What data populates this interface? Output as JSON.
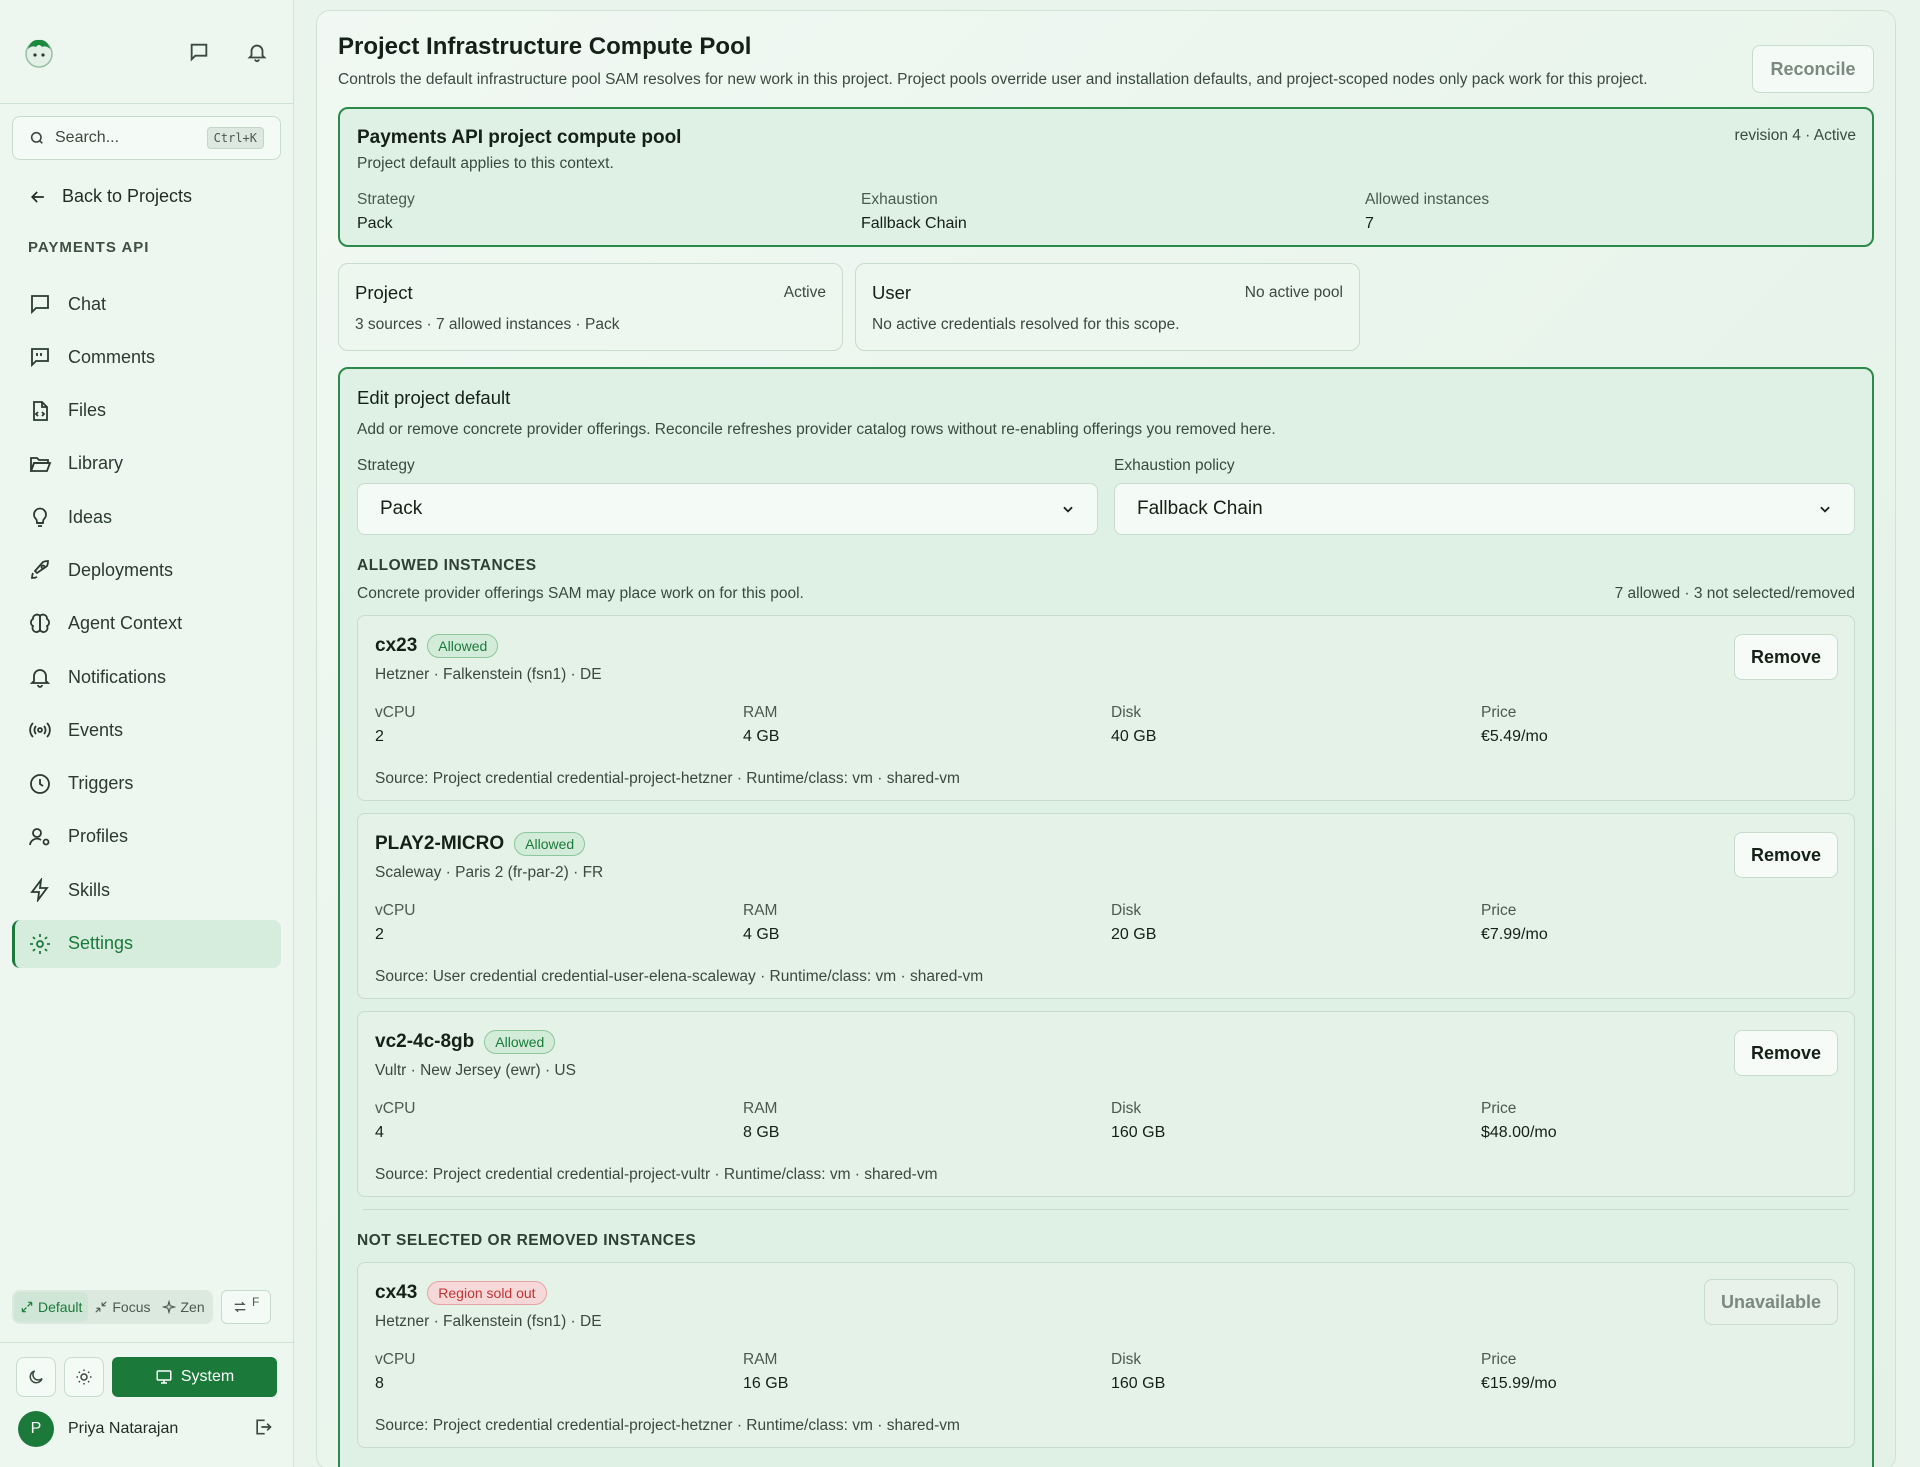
{
  "sidebar": {
    "search_placeholder": "Search...",
    "search_shortcut": "Ctrl+K",
    "back_label": "Back to Projects",
    "project_label": "PAYMENTS API",
    "items": [
      {
        "label": "Chat",
        "icon": "chat-icon"
      },
      {
        "label": "Comments",
        "icon": "comments-icon"
      },
      {
        "label": "Files",
        "icon": "file-code-icon"
      },
      {
        "label": "Library",
        "icon": "folder-open-icon"
      },
      {
        "label": "Ideas",
        "icon": "lightbulb-icon"
      },
      {
        "label": "Deployments",
        "icon": "rocket-icon"
      },
      {
        "label": "Agent Context",
        "icon": "brain-icon"
      },
      {
        "label": "Notifications",
        "icon": "bell-icon"
      },
      {
        "label": "Events",
        "icon": "radio-icon"
      },
      {
        "label": "Triggers",
        "icon": "clock-icon"
      },
      {
        "label": "Profiles",
        "icon": "user-cog-icon"
      },
      {
        "label": "Skills",
        "icon": "bolt-icon"
      },
      {
        "label": "Settings",
        "icon": "gear-icon",
        "active": true
      }
    ],
    "layout_modes": {
      "default": "Default",
      "focus": "Focus",
      "zen": "Zen",
      "toggle_key": "F"
    },
    "theme_system": "System",
    "user": {
      "initial": "P",
      "name": "Priya Natarajan"
    }
  },
  "header": {
    "title": "Project Infrastructure Compute Pool",
    "description": "Controls the default infrastructure pool SAM resolves for new work in this project. Project pools override user and installation defaults, and project-scoped nodes only pack work for this project.",
    "reconcile_label": "Reconcile"
  },
  "pool": {
    "name": "Payments API project compute pool",
    "subtitle": "Project default applies to this context.",
    "revision": "revision 4 · Active",
    "fields": [
      {
        "key": "Strategy",
        "value": "Pack"
      },
      {
        "key": "Exhaustion",
        "value": "Fallback Chain"
      },
      {
        "key": "Allowed instances",
        "value": "7"
      }
    ]
  },
  "scopes": [
    {
      "name": "Project",
      "state": "Active",
      "desc": "3 sources · 7 allowed instances · Pack"
    },
    {
      "name": "User",
      "state": "No active pool",
      "desc": "No active credentials resolved for this scope."
    }
  ],
  "edit": {
    "title": "Edit project default",
    "desc": "Add or remove concrete provider offerings. Reconcile refreshes provider catalog rows without re-enabling offerings you removed here.",
    "strategy_label": "Strategy",
    "strategy_value": "Pack",
    "exhaustion_label": "Exhaustion policy",
    "exhaustion_value": "Fallback Chain",
    "allowed_heading": "ALLOWED INSTANCES",
    "allowed_desc": "Concrete provider offerings SAM may place work on for this pool.",
    "allowed_count": "7 allowed · 3 not selected/removed",
    "not_selected_heading": "NOT SELECTED OR REMOVED INSTANCES",
    "spec_labels": {
      "vcpu": "vCPU",
      "ram": "RAM",
      "disk": "Disk",
      "price": "Price"
    },
    "allowed": [
      {
        "name": "cx23",
        "badge": "Allowed",
        "provider": "Hetzner · Falkenstein (fsn1) · DE",
        "vcpu": "2",
        "ram": "4 GB",
        "disk": "40 GB",
        "price": "€5.49/mo",
        "source": "Source: Project credential credential-project-hetzner · Runtime/class: vm · shared-vm",
        "action": "Remove"
      },
      {
        "name": "PLAY2-MICRO",
        "badge": "Allowed",
        "provider": "Scaleway · Paris 2 (fr-par-2) · FR",
        "vcpu": "2",
        "ram": "4 GB",
        "disk": "20 GB",
        "price": "€7.99/mo",
        "source": "Source: User credential credential-user-elena-scaleway · Runtime/class: vm · shared-vm",
        "action": "Remove"
      },
      {
        "name": "vc2-4c-8gb",
        "badge": "Allowed",
        "provider": "Vultr · New Jersey (ewr) · US",
        "vcpu": "4",
        "ram": "8 GB",
        "disk": "160 GB",
        "price": "$48.00/mo",
        "source": "Source: Project credential credential-project-vultr · Runtime/class: vm · shared-vm",
        "action": "Remove"
      }
    ],
    "not_selected": [
      {
        "name": "cx43",
        "badge": "Region sold out",
        "provider": "Hetzner · Falkenstein (fsn1) · DE",
        "vcpu": "8",
        "ram": "16 GB",
        "disk": "160 GB",
        "price": "€15.99/mo",
        "source": "Source: Project credential credential-project-hetzner · Runtime/class: vm · shared-vm",
        "action": "Unavailable"
      }
    ]
  }
}
